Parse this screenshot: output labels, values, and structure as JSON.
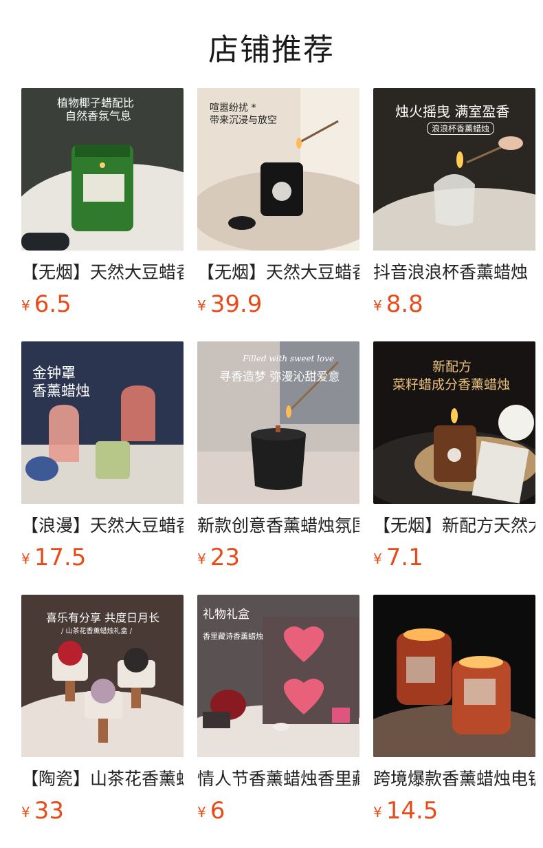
{
  "page_title": "店铺推荐",
  "currency": "¥",
  "accent_color": "#e84b1a",
  "products": [
    {
      "name": "【无烟】天然大豆蜡香薰蜡烛",
      "price": "6.5",
      "overlay": [
        "植物椰子蜡配比",
        "自然香氛气息"
      ]
    },
    {
      "name": "【无烟】天然大豆蜡香薰蜡烛",
      "price": "39.9",
      "overlay": [
        "喧嚣纷扰 *",
        "带来沉浸与放空"
      ]
    },
    {
      "name": "抖音浪浪杯香薰蜡烛",
      "price": "8.8",
      "overlay": [
        "烛火摇曳  满室盈香",
        "浪浪杯香薰蜡烛"
      ]
    },
    {
      "name": "【浪漫】天然大豆蜡香薰蜡烛",
      "price": "17.5",
      "overlay": [
        "金钟罩",
        "香薰蜡烛"
      ]
    },
    {
      "name": "新款创意香薰蜡烛氛围",
      "price": "23",
      "overlay": [
        "Filled with sweet love",
        "寻香造梦  弥漫沁甜爱意"
      ]
    },
    {
      "name": "【无烟】新配方天然大豆蜡",
      "price": "7.1",
      "overlay": [
        "新配方",
        "菜籽蜡成分香薰蜡烛"
      ]
    },
    {
      "name": "【陶瓷】山茶花香薰蜡烛",
      "price": "33",
      "overlay": [
        "喜乐有分享  共度日月长",
        "/ 山茶花香薰蜡烛礼盒 /"
      ]
    },
    {
      "name": "情人节香薰蜡烛香里藏诗",
      "price": "6",
      "overlay": [
        "礼物礼盒",
        "香里藏诗香薰蜡烛"
      ]
    },
    {
      "name": "跨境爆款香薰蜡烛电镀杯",
      "price": "14.5",
      "overlay": []
    }
  ]
}
